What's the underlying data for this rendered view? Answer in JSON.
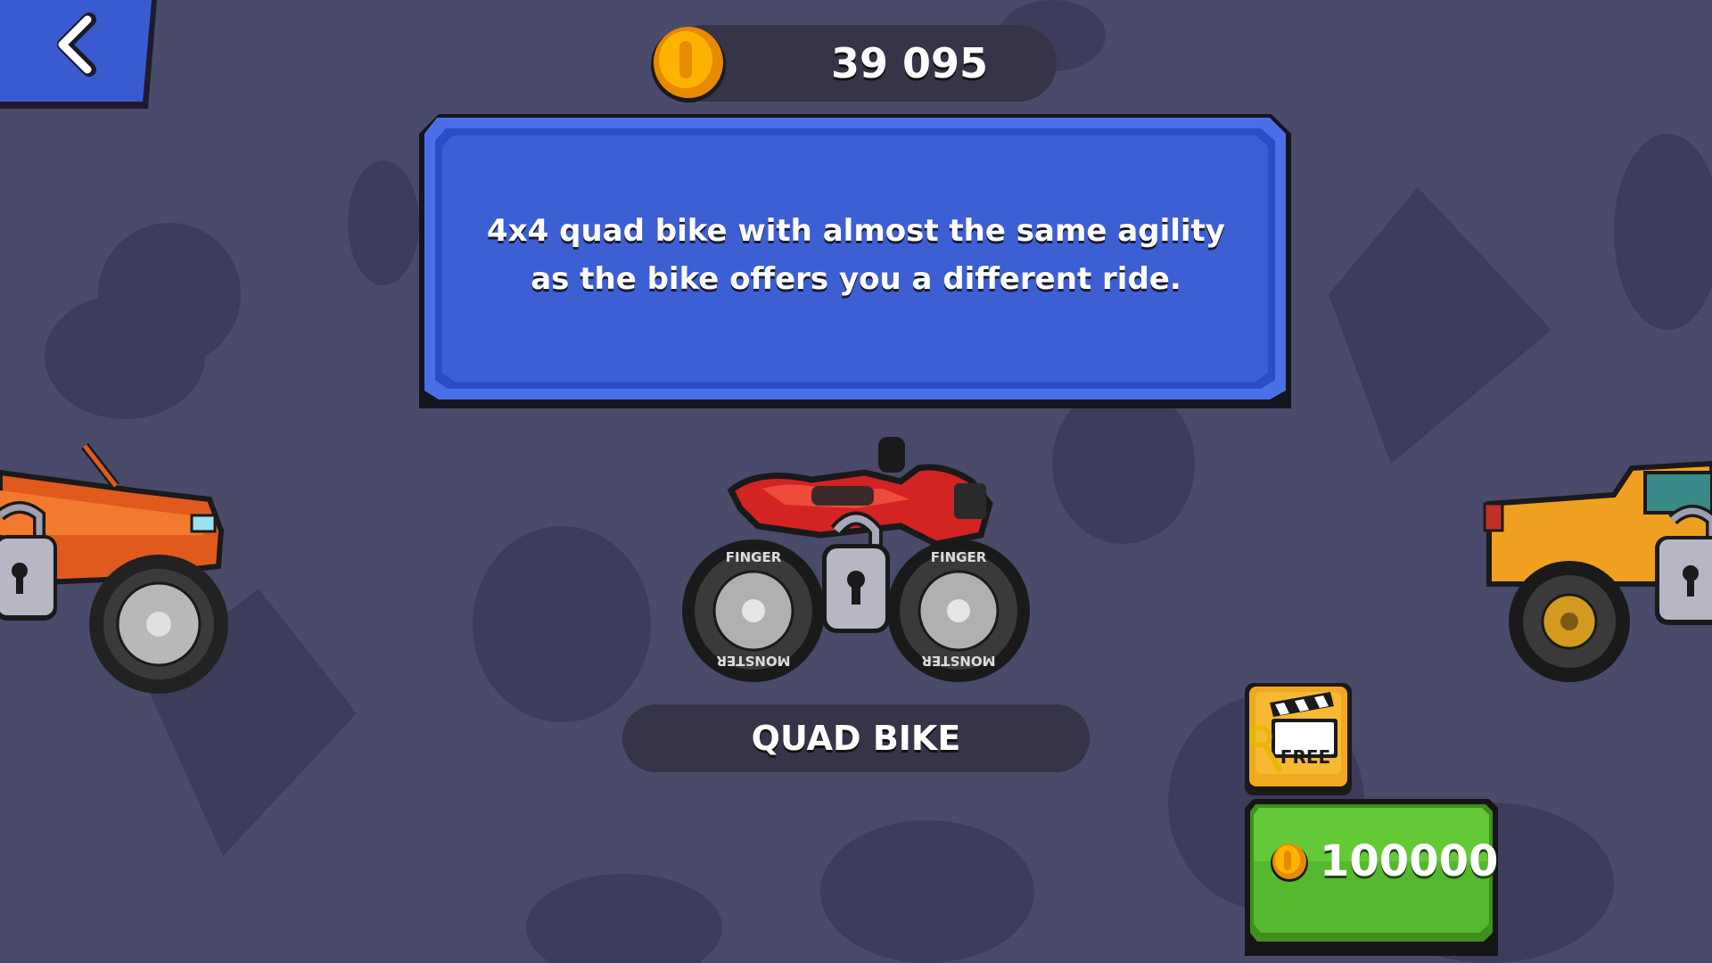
{
  "header": {
    "coin_balance": "39 095",
    "coin_icon": "gold-coin-icon",
    "back_icon": "chevron-left-icon"
  },
  "vehicle": {
    "description": "4x4 quad bike with almost the same agility as the bike offers you a different ride.",
    "name": "QUAD BIKE",
    "locked": true,
    "wheel_text_top": "FINGER",
    "wheel_text_bottom": "MONSTER"
  },
  "actions": {
    "free_label": "FREE",
    "free_icon": "clapperboard-key-icon",
    "price": "100000",
    "price_icon": "gold-coin-icon"
  },
  "neighbors": {
    "left_locked": true,
    "right_locked": true
  },
  "colors": {
    "background": "#4a4a6a",
    "panel_blue": "#3d5fd4",
    "buy_green": "#4fae2a",
    "coin_gold": "#f5a300",
    "quad_red": "#d42323"
  }
}
